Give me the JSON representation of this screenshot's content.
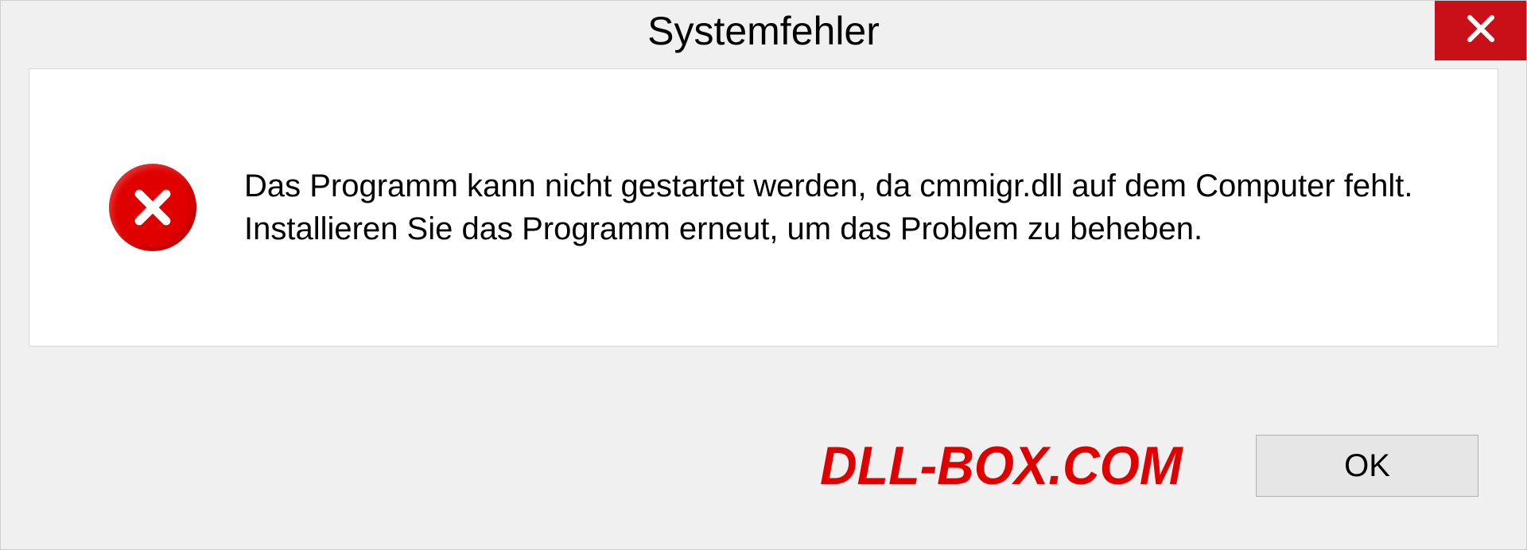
{
  "dialog": {
    "title": "Systemfehler",
    "error_message": "Das Programm kann nicht gestartet werden, da cmmigr.dll auf dem Computer fehlt. Installieren Sie das Programm erneut, um das Problem zu beheben.",
    "watermark": "DLL-BOX.COM",
    "ok_label": "OK"
  }
}
